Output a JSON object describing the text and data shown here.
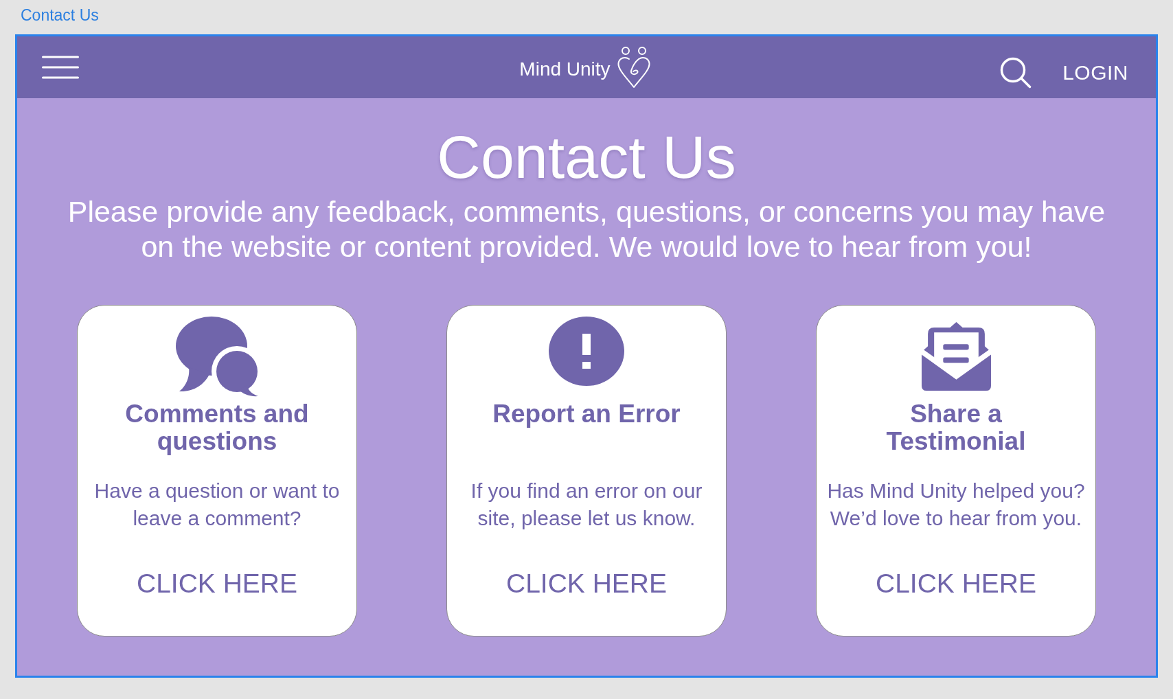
{
  "top_label": "Contact Us",
  "header": {
    "logo_text": "Mind Unity",
    "login": "LOGIN"
  },
  "hero": {
    "title": "Contact Us",
    "text": "Please provide any feedback, comments, questions, or concerns you may have on the website or content provided. We would love to hear from you!"
  },
  "cards": [
    {
      "kind": "comments",
      "title": "Comments and questions",
      "text": "Have a question or want to leave a comment?",
      "link": "CLICK HERE"
    },
    {
      "kind": "error",
      "title": "Report an Error",
      "text": "If you find an error on our site, please let us know.",
      "link": "CLICK HERE"
    },
    {
      "kind": "testimonial",
      "title": "Share a Testimonial",
      "text": "Has Mind Unity helped you? We’d love to hear from you.",
      "link": "CLICK HERE"
    }
  ]
}
